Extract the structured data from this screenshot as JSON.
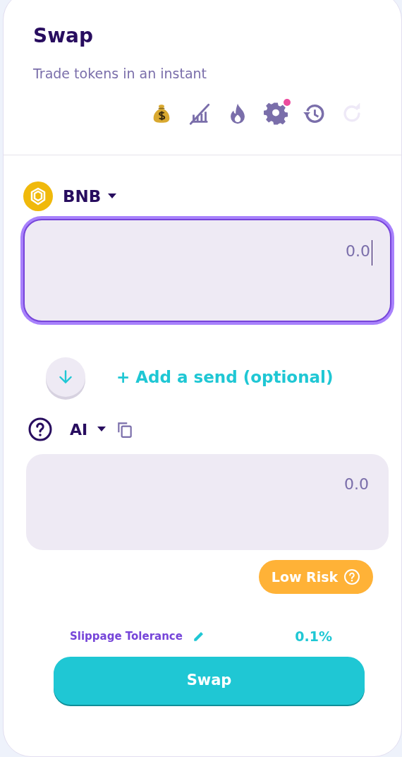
{
  "header": {
    "title": "Swap",
    "subtitle": "Trade tokens in an instant"
  },
  "toolbar": [
    {
      "kind": "money",
      "disabled": false,
      "notification": false
    },
    {
      "kind": "chart-off",
      "disabled": false,
      "notification": false
    },
    {
      "kind": "flame",
      "disabled": false,
      "notification": false
    },
    {
      "kind": "settings",
      "disabled": false,
      "notification": true
    },
    {
      "kind": "history",
      "disabled": false,
      "notification": false
    },
    {
      "kind": "refresh",
      "disabled": true,
      "notification": false
    }
  ],
  "from": {
    "token": "BNB",
    "amount": {
      "placeholder": "0.0",
      "focused": true
    }
  },
  "add_send": {
    "label": "+ Add a send (optional)"
  },
  "to": {
    "token": "AI",
    "amount": {
      "placeholder": "0.0",
      "focused": false
    }
  },
  "risk": {
    "label": "Low Risk"
  },
  "slippage": {
    "label": "Slippage Tolerance",
    "value": "0.1%"
  },
  "swap_button": {
    "label": "Swap"
  }
}
